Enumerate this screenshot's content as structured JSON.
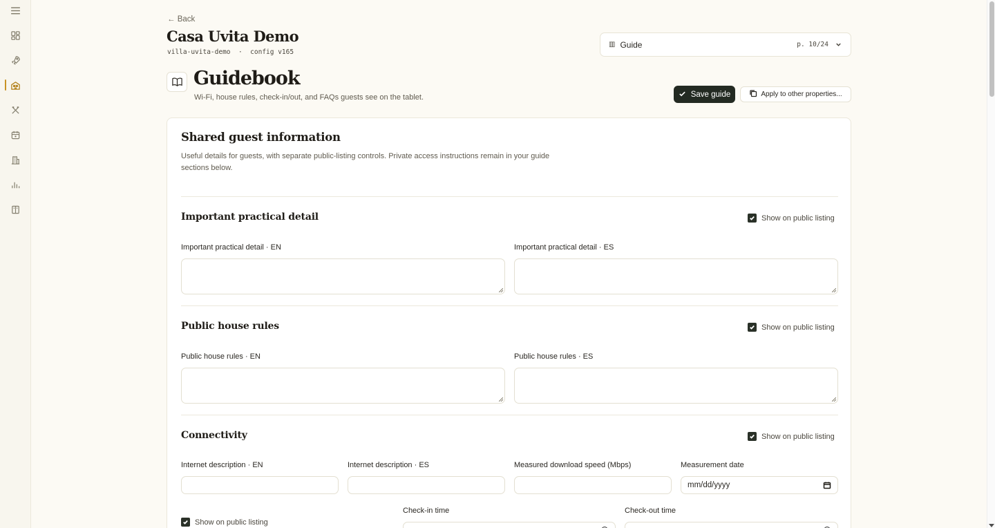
{
  "header": {
    "back_label": "← Back",
    "project_title": "Casa Uvita Demo",
    "project_slug": "villa-uvita-demo",
    "meta_separator": "·",
    "project_config": "config v165",
    "guide_select": {
      "icon": "▥",
      "label": "Guide",
      "page": "p. 10/24"
    }
  },
  "page": {
    "title": "Guidebook",
    "subtitle": "Wi-Fi, house rules, check-in/out, and FAQs guests see on the tablet.",
    "save_label": "Save guide",
    "apply_label": "Apply to other properties..."
  },
  "card": {
    "title": "Shared guest information",
    "description": "Useful details for guests, with separate public-listing controls. Private access instructions remain in your guide sections below."
  },
  "sections": {
    "practical": {
      "title": "Important practical detail",
      "public_label": "Show on public listing",
      "public_checked": true,
      "field_en_label": "Important practical detail · EN",
      "field_es_label": "Important practical detail · ES"
    },
    "rules": {
      "title": "Public house rules",
      "public_label": "Show on public listing",
      "public_checked": true,
      "field_en_label": "Public house rules · EN",
      "field_es_label": "Public house rules · ES"
    },
    "connectivity": {
      "title": "Connectivity",
      "public_label": "Show on public listing",
      "public_checked": true,
      "internet_en_label": "Internet description · EN",
      "internet_es_label": "Internet description · ES",
      "speed_label": "Measured download speed (Mbps)",
      "date_label": "Measurement date",
      "date_placeholder": "mm/dd/yyyy"
    },
    "checkin": {
      "public_label": "Show on public listing",
      "public_checked": true,
      "checkin_label": "Check-in time",
      "checkout_label": "Check-out time"
    }
  },
  "colors": {
    "accent": "#c99324",
    "primary_button": "#232a22",
    "background": "#fcfaf4"
  },
  "icons": {
    "rail": [
      "menu-icon",
      "dashboard-icon",
      "rocket-icon",
      "home-icon",
      "utensils-icon",
      "calendar-icon",
      "building-icon",
      "bar-chart-icon",
      "book-open-icon"
    ]
  }
}
